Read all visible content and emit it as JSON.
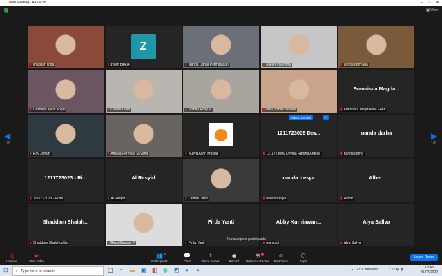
{
  "window": {
    "title": "Zoom Meeting - A4-VR75"
  },
  "view_label": "View",
  "tiles": [
    {
      "label": "Ilhaddar Yoda",
      "kind": "photo",
      "bg": "#8a4a3a"
    },
    {
      "label": "zoom ba404",
      "kind": "avatar",
      "avatar": "Z"
    },
    {
      "label": "Nanda Darha Permatasari",
      "kind": "photo",
      "bg": "#6b6f78"
    },
    {
      "label": "Aileen Valentina",
      "kind": "photo",
      "bg": "#c6c6c6",
      "active": true
    },
    {
      "label": "angga permana",
      "kind": "photo",
      "bg": "#7a5a3a"
    },
    {
      "label": "Dasnaya Alicia Angel",
      "kind": "photo",
      "bg": "#6a5560"
    },
    {
      "label": "Latifah Ulfah",
      "kind": "photo",
      "bg": "#b9b5b0"
    },
    {
      "label": "Shintia Rosy P",
      "kind": "photo",
      "bg": "#a8a49e"
    },
    {
      "label": "erica nabila oktavia",
      "kind": "photo",
      "bg": "#c8a58a"
    },
    {
      "label": "Fransisca Magdalena Foeh",
      "kind": "name",
      "big": "Fransisca  Magda..."
    },
    {
      "label": "Roy Jonsin",
      "kind": "photo",
      "bg": "#2f3a40"
    },
    {
      "label": "Amalia Permata Suyana",
      "kind": "photo",
      "bg": "#6a6460"
    },
    {
      "label": "Auliya Ashri Mustar",
      "kind": "orange"
    },
    {
      "label": "1211723009 Devina Rahma Ardelia",
      "kind": "name",
      "big": "1211723009  Dev...",
      "ask": true
    },
    {
      "label": "nanda darha",
      "kind": "name",
      "big": "nanda  darha"
    },
    {
      "label": "1211723023 - Rista",
      "kind": "name",
      "big": "1211723023  -  Ri..."
    },
    {
      "label": "Al Rasyid",
      "kind": "name",
      "big": "Al  Rasyid"
    },
    {
      "label": "Latifah Ulfah",
      "kind": "photo",
      "bg": "#3a3a3a"
    },
    {
      "label": "nanda tresya",
      "kind": "name",
      "big": "nanda  tresya"
    },
    {
      "label": "Albert",
      "kind": "name",
      "big": "Albert"
    },
    {
      "label": "Shaddam Shalahuddin",
      "kind": "name",
      "big": "Shaddam  Shalah..."
    },
    {
      "label": "Reza Baggas P",
      "kind": "photo",
      "bg": "#dcdcdc"
    },
    {
      "label": "Firda Yanti",
      "kind": "name",
      "big": "Firda  Yanti"
    },
    {
      "label": "maniguti",
      "kind": "name",
      "big": "Abby  Kurniawan..."
    },
    {
      "label": "Alya Sallva",
      "kind": "name",
      "big": "Alya  Sallva"
    }
  ],
  "ask_to_unmute": "Ask to Unmute",
  "more": "...",
  "unassigned": "4 unassigned participants",
  "page_left": "1/2",
  "page_right": "1/2",
  "toolbar": {
    "unmute": "Unmute",
    "start_video": "Start Video",
    "participants": "Participants",
    "participants_count": "28",
    "chat": "Chat",
    "share_screen": "Share Screen",
    "record": "Record",
    "breakout_rooms": "Breakout Rooms",
    "breakout_badge": "4",
    "reactions": "Reactions",
    "apps": "Apps",
    "leave": "Leave Room"
  },
  "taskbar": {
    "search_placeholder": "Type here to search",
    "weather": "27°C  Berawan",
    "time": "18:48",
    "date": "31/03/2022"
  }
}
